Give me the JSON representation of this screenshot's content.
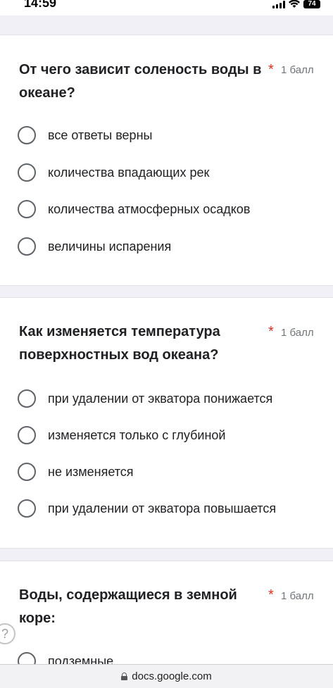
{
  "status": {
    "time": "14:59",
    "battery": "74"
  },
  "questions": [
    {
      "title": "От чего зависит соленость воды в океане?",
      "required_mark": "*",
      "points": "1 балл",
      "options": [
        "все ответы верны",
        "количества впадающих рек",
        "количества атмосферных осадков",
        "величины испарения"
      ]
    },
    {
      "title": "Как изменяется температура поверхностных вод океана?",
      "required_mark": "*",
      "points": "1 балл",
      "options": [
        "при удалении от экватора понижается",
        "изменяется только с глубиной",
        "не изменяется",
        "при удалении от экватора повышается"
      ]
    },
    {
      "title": "Воды, содержащиеся в земной коре:",
      "required_mark": "*",
      "points": "1 балл",
      "options": [
        "подземные"
      ]
    }
  ],
  "help": {
    "label": "?"
  },
  "browser": {
    "url": "docs.google.com"
  }
}
